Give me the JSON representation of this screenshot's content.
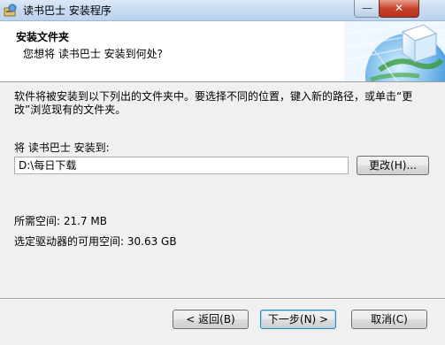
{
  "window": {
    "title": "读书巴士 安装程序",
    "minimize_glyph": "—",
    "close_glyph": "✕"
  },
  "header": {
    "title": "安装文件夹",
    "subtitle": "您想将 读书巴士 安装到何处?"
  },
  "content": {
    "description": "软件将被安装到以下列出的文件夹中。要选择不同的位置，键入新的路径，或单击“更改”浏览现有的文件夹。",
    "install_label": "将 读书巴士 安装到:",
    "install_path": "D:\\每日下载",
    "change_button": "更改(H)...",
    "space_required": "所需空间: 21.7 MB",
    "space_available": "选定驱动器的可用空间: 30.63 GB"
  },
  "footer": {
    "back_button": "< 返回(B)",
    "next_button": "下一步(N) >",
    "cancel_button": "取消(C)"
  },
  "icons": {
    "app": "installer-icon",
    "header_art": "globe-cube-icon"
  }
}
